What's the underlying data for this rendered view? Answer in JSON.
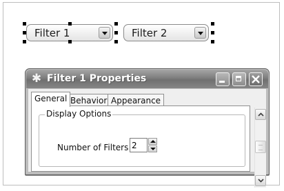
{
  "filters": {
    "filter1_label": "Filter 1",
    "filter2_label": "Filter 2",
    "dropdown_icon": "chevron-down-icon"
  },
  "dialog": {
    "title": "Filter 1 Properties",
    "title_icon": "filter-icon",
    "tabs": [
      {
        "label": "General",
        "active": true
      },
      {
        "label": "Behavior",
        "active": false
      },
      {
        "label": "Appearance",
        "active": false
      }
    ],
    "group_title": "Display Options",
    "number_label": "Number of Filters",
    "number_value": "2"
  },
  "colors": {
    "titlebar": "#7e7e7e",
    "title_text": "#ffffff",
    "client_bg": "#efefef"
  }
}
